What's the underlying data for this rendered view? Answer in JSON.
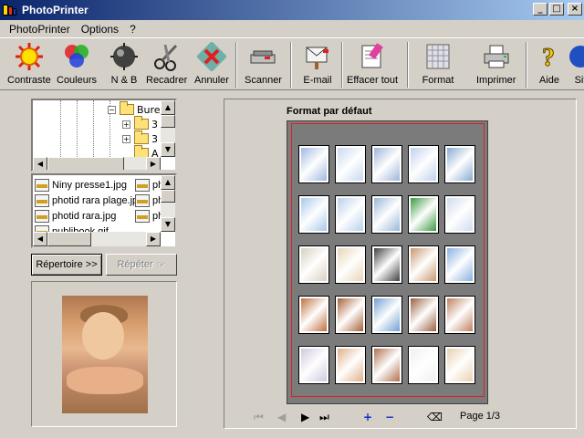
{
  "window": {
    "title": "PhotoPrinter"
  },
  "menu": [
    {
      "label": "PhotoPrinter"
    },
    {
      "label": "Options"
    },
    {
      "label": "?"
    }
  ],
  "toolbar": {
    "contraste": "Contraste",
    "couleurs": "Couleurs",
    "nb": "N & B",
    "recadrer": "Recadrer",
    "annuler": "Annuler",
    "scanner": "Scanner",
    "email": "E-mail",
    "effacer": "Effacer tout",
    "format": "Format",
    "imprimer": "Imprimer",
    "aide": "Aide",
    "site": "Sit"
  },
  "tree": {
    "items": [
      {
        "label": "Burea"
      },
      {
        "label": "3"
      },
      {
        "label": "3"
      },
      {
        "label": "A"
      }
    ]
  },
  "files": {
    "col1": [
      "Niny presse1.jpg",
      "photid rara plage.jpg",
      "photid rara.jpg",
      "publibook.gif"
    ],
    "col2": [
      "ph",
      "ph",
      "ph"
    ]
  },
  "buttons": {
    "repertoire": "Répertoire >>",
    "repeter": "Répéter"
  },
  "preview": {
    "title": "Format par défaut"
  },
  "pager": {
    "label": "Page 1/3",
    "plus": "+",
    "minus": "−"
  },
  "thumbnail_palette": [
    [
      "#a0b8e0",
      "#c8d8f0",
      "#9eb4d8",
      "#c0d0ec",
      "#88aad0"
    ],
    [
      "#a8c8e8",
      "#b8d0ec",
      "#98b8d8",
      "#3a9a40",
      "#d0dcec"
    ],
    [
      "#d8d0c0",
      "#e8d4b8",
      "#404040",
      "#c89870",
      "#88b0e0"
    ],
    [
      "#c07040",
      "#a86038",
      "#70a0d0",
      "#9a6040",
      "#c08060"
    ],
    [
      "#d0c8e0",
      "#e0b088",
      "#b07050",
      "#f0f0f0",
      "#e8d0b0"
    ]
  ]
}
